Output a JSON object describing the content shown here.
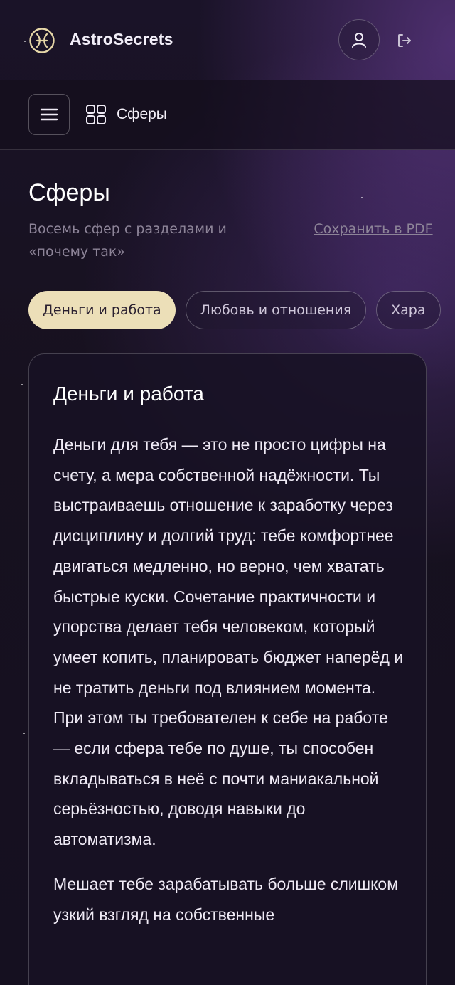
{
  "app": {
    "brand_name": "AstroSecrets"
  },
  "subnav": {
    "section_label": "Сферы"
  },
  "page": {
    "title": "Сферы",
    "subtitle": "Восемь сфер с разделами и «почему так»",
    "save_pdf_label": "Сохранить в PDF"
  },
  "tabs": [
    {
      "label": "Деньги и работа",
      "active": true
    },
    {
      "label": "Любовь и отношения",
      "active": false
    },
    {
      "label": "Хара",
      "active": false
    }
  ],
  "card": {
    "title": "Деньги и работа",
    "paragraphs": [
      "Деньги для тебя — это не просто цифры на счету, а мера собственной надёжности. Ты выстраиваешь отношение к заработку через дисциплину и долгий труд: тебе комфортнее двигаться медленно, но верно, чем хватать быстрые куски. Сочетание практичности и упорства делает тебя человеком, который умеет копить, планировать бюджет наперёд и не тратить деньги под влиянием момента. При этом ты требователен к себе на работе — если сфера тебе по душе, ты способен вкладываться в неё с почти маниакальной серьёзностью, доводя навыки до автоматизма.",
      "Мешает тебе зарабатывать больше слишком узкий взгляд на собственные"
    ]
  },
  "colors": {
    "accent_tab": "#ecdfb8",
    "accent_gold": "#e6d7a8",
    "muted_text": "#8d8498"
  },
  "icons": {
    "logo": "astro-logo-icon",
    "user": "user-icon",
    "logout": "logout-icon",
    "menu": "hamburger-icon",
    "section": "grid-icon"
  }
}
